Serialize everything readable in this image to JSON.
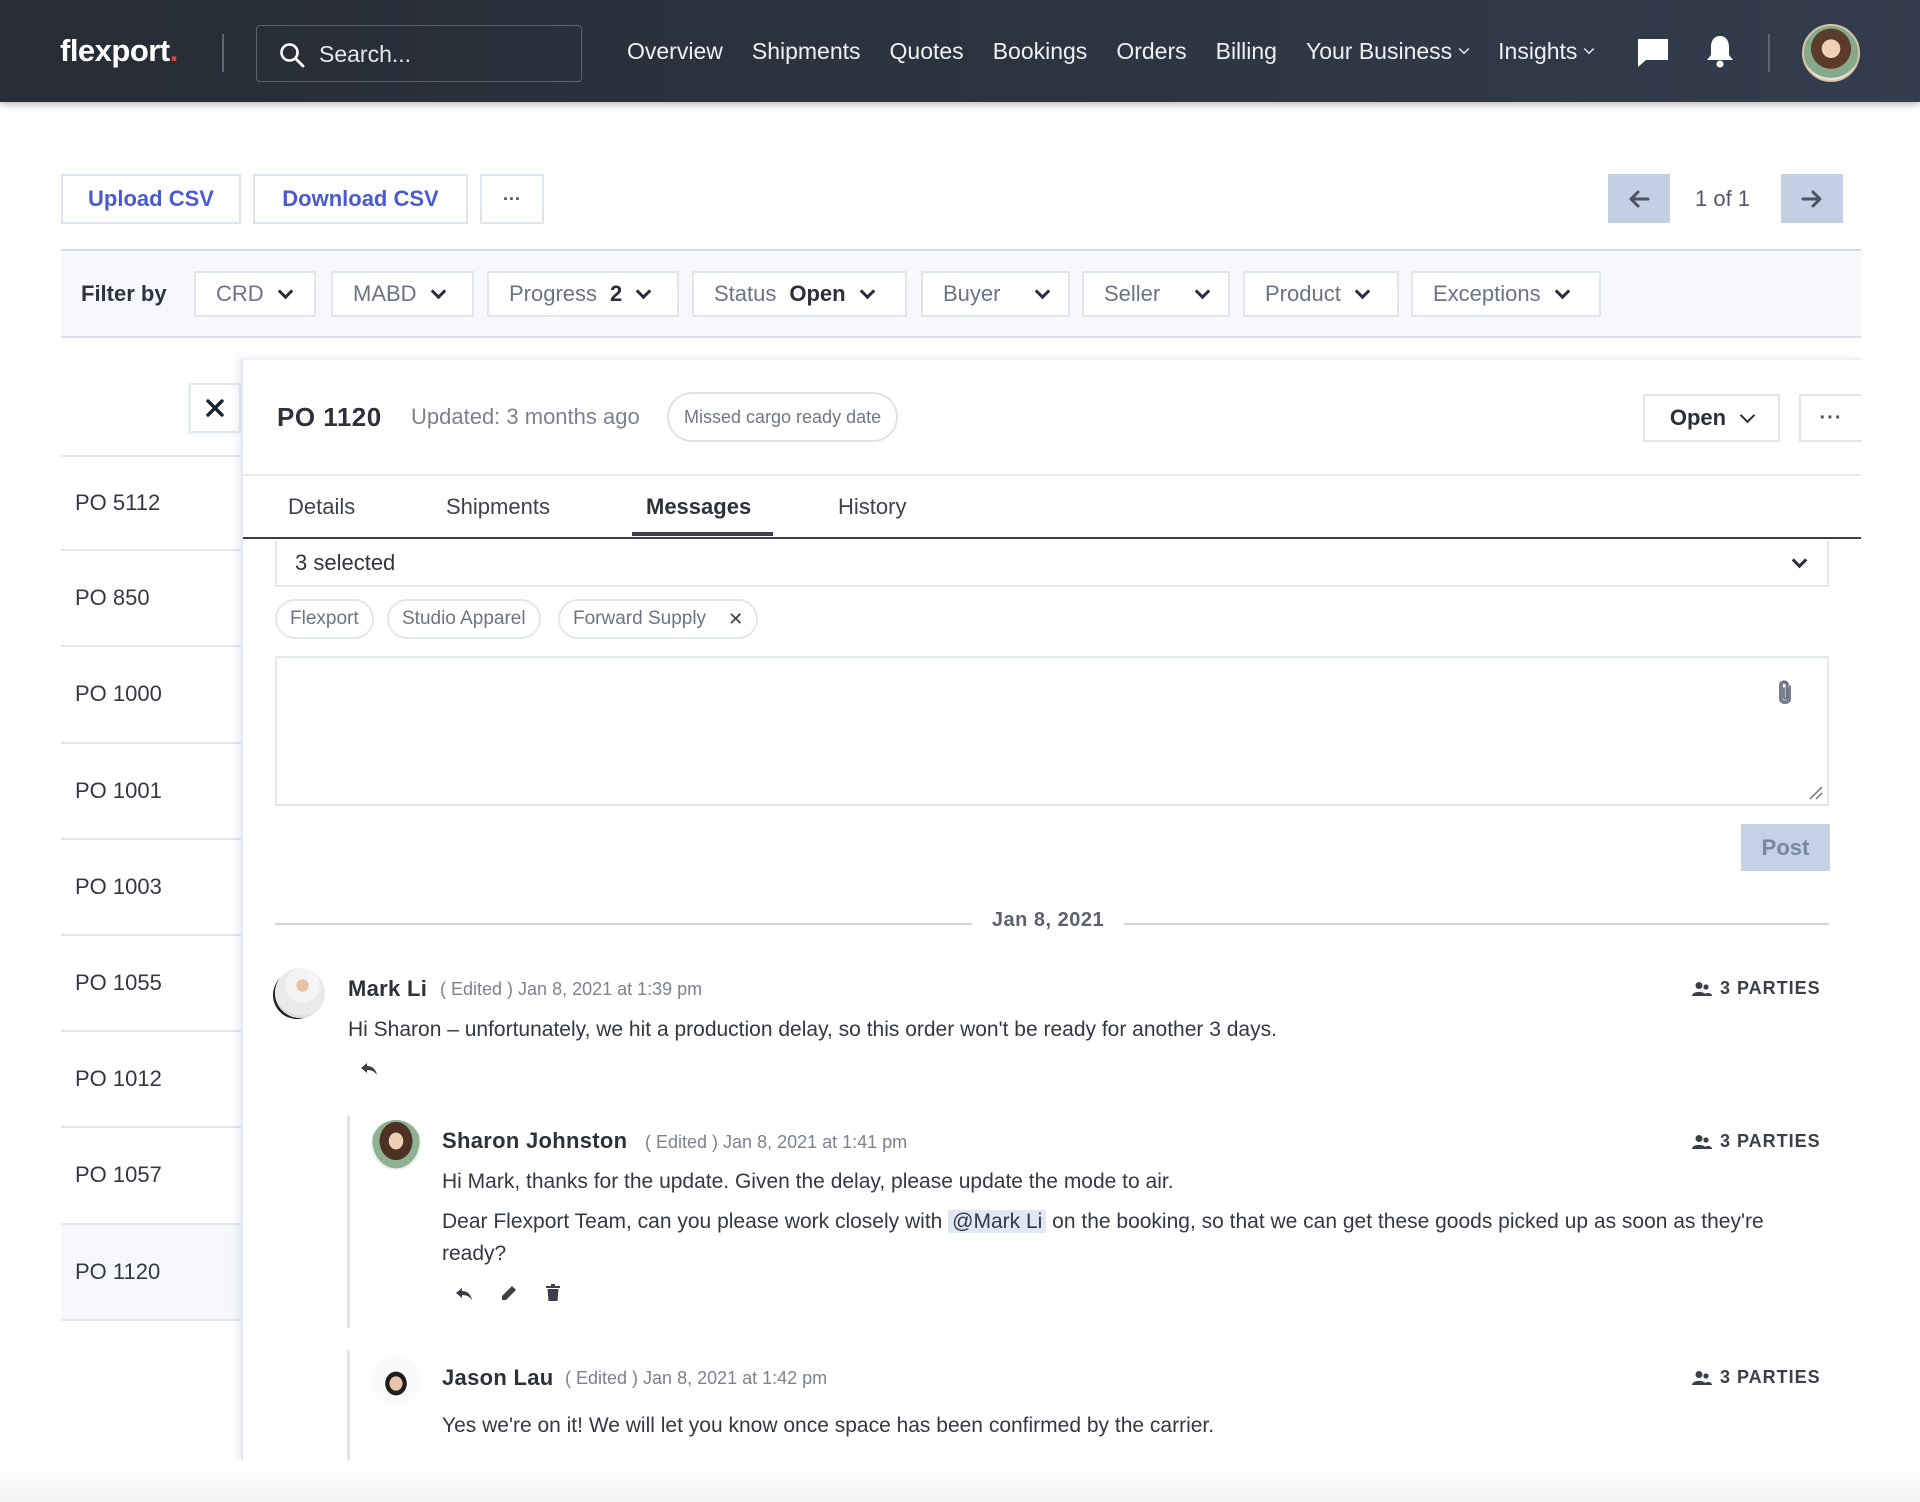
{
  "header": {
    "logo_text": "flexport",
    "logo_dot": ".",
    "search_placeholder": "Search...",
    "nav": [
      {
        "label": "Overview",
        "has_dropdown": false
      },
      {
        "label": "Shipments",
        "has_dropdown": false
      },
      {
        "label": "Quotes",
        "has_dropdown": false
      },
      {
        "label": "Bookings",
        "has_dropdown": false
      },
      {
        "label": "Orders",
        "has_dropdown": false
      },
      {
        "label": "Billing",
        "has_dropdown": false
      },
      {
        "label": "Your Business",
        "has_dropdown": true
      },
      {
        "label": "Insights",
        "has_dropdown": true
      }
    ],
    "icons": [
      "chat-icon",
      "bell-icon"
    ],
    "user_avatar": "user-avatar"
  },
  "toolbar": {
    "upload_label": "Upload CSV",
    "download_label": "Download CSV",
    "more_label": "···",
    "pager_text": "1 of 1"
  },
  "filters": {
    "label": "Filter by",
    "chips": [
      {
        "name": "CRD",
        "value": ""
      },
      {
        "name": "MABD",
        "value": ""
      },
      {
        "name": "Progress",
        "value": "2"
      },
      {
        "name": "Status",
        "value": "Open"
      },
      {
        "name": "Buyer",
        "value": ""
      },
      {
        "name": "Seller",
        "value": ""
      },
      {
        "name": "Product",
        "value": ""
      },
      {
        "name": "Exceptions",
        "value": ""
      }
    ]
  },
  "po_list": {
    "items": [
      "PO 5112",
      "PO 850",
      "PO 1000",
      "PO 1001",
      "PO 1003",
      "PO 1055",
      "PO 1012",
      "PO 1057",
      "PO 1120"
    ],
    "active": "PO 1120"
  },
  "detail": {
    "title": "PO 1120",
    "updated": "Updated: 3 months ago",
    "exception": "Missed cargo ready date",
    "status": "Open",
    "more_label": "···",
    "tabs": [
      {
        "label": "Details",
        "active": false
      },
      {
        "label": "Shipments",
        "active": false
      },
      {
        "label": "Messages",
        "active": true
      },
      {
        "label": "History",
        "active": false
      }
    ],
    "recipients_summary": "3 selected",
    "recipients": [
      {
        "label": "Flexport",
        "removable": false
      },
      {
        "label": "Studio Apparel",
        "removable": false
      },
      {
        "label": "Forward Supply",
        "removable": true
      }
    ],
    "composer_placeholder": "",
    "post_label": "Post",
    "date_divider": "Jan 8, 2021",
    "messages": [
      {
        "author": "Mark Li",
        "edited": "( Edited )",
        "timestamp": "Jan 8, 2021 at 1:39 pm",
        "parties": "3 PARTIES",
        "body": [
          "Hi Sharon – unfortunately, we hit a production delay, so this order won't be ready for another 3 days."
        ],
        "actions": [
          "reply"
        ]
      },
      {
        "author": "Sharon Johnston",
        "edited": "( Edited )",
        "timestamp": "Jan 8, 2021 at 1:41 pm",
        "parties": "3 PARTIES",
        "body_line1": "Hi Mark, thanks for the update. Given the delay, please update the mode to air.",
        "body_line2_pre": "Dear Flexport Team, can you please work closely with ",
        "mention": "@Mark Li",
        "body_line2_post": " on the booking, so that we can get these goods picked up as soon as they're ready?",
        "actions": [
          "reply",
          "edit",
          "delete"
        ]
      },
      {
        "author": "Jason Lau",
        "edited": "( Edited )",
        "timestamp": "Jan 8, 2021 at 1:42 pm",
        "parties": "3 PARTIES",
        "body": [
          "Yes we're on it! We will let you know once space has been confirmed by the carrier."
        ]
      }
    ]
  },
  "colors": {
    "nav_bg": "#2a303b",
    "accent_blue": "#4a5bd0",
    "pager_bg": "#c3cfe2",
    "post_disabled": "#c5d1e4",
    "brand_dot": "#e0453d"
  }
}
